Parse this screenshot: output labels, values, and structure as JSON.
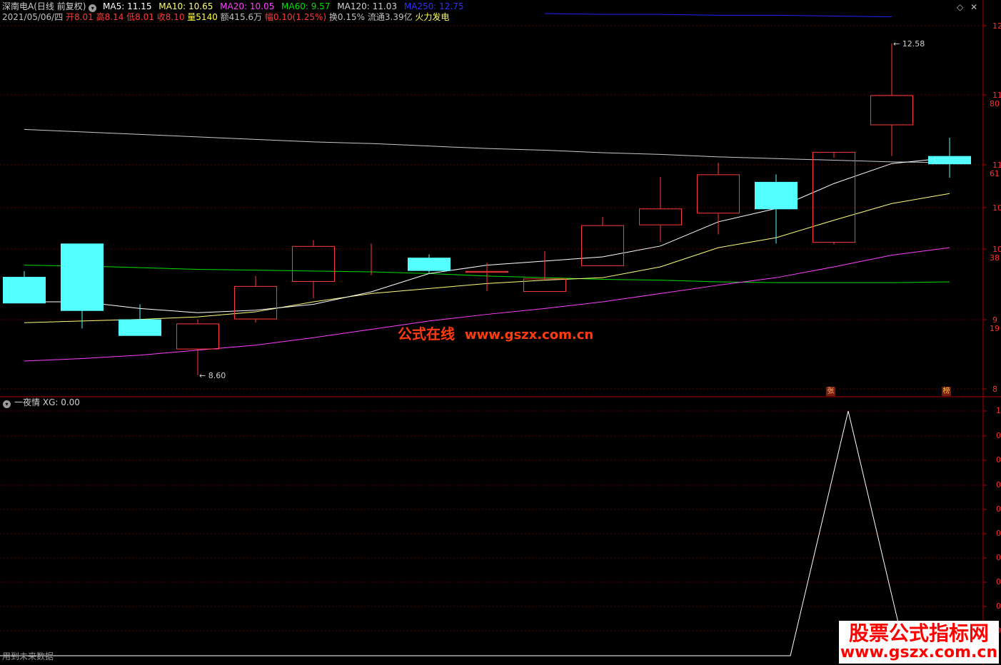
{
  "header": {
    "stock": "深南电A(日线 前复权)",
    "ma5": "MA5: 11.15",
    "ma10": "MA10: 10.65",
    "ma20": "MA20: 10.05",
    "ma60": "MA60: 9.57",
    "ma120": "MA120: 11.03",
    "ma250": "MA250: 12.75"
  },
  "quote": {
    "date": "2021/05/06/四",
    "open": "开8.01",
    "high": "高8.14",
    "low": "低8.01",
    "close": "收8.10",
    "volume": "量5140",
    "amount": "额415.6万",
    "change": "幅0.10(1.25%)",
    "turnover": "换0.15%",
    "float": "流通3.39亿",
    "sector": "火力发电"
  },
  "annotations": {
    "high_label": "12.58",
    "low_label": "8.60",
    "badge_zhang": "张",
    "badge_bang": "榜"
  },
  "axis": {
    "right_labels": [
      "12",
      "11",
      "80",
      "11",
      "61",
      "10",
      "10",
      "38",
      "9",
      "19",
      "8"
    ],
    "ind_labels": [
      "1",
      "0",
      "0",
      "0",
      "0",
      "0",
      "0",
      "0",
      "0",
      "0"
    ]
  },
  "indicator": {
    "name": "一夜情",
    "value": "XG: 0.00"
  },
  "footer": {
    "note": "用到未来数据"
  },
  "watermark": {
    "cn": "公式在线",
    "url": "www.gszx.com.cn"
  },
  "brand": {
    "title": "股票公式指标网",
    "url": "www.gszx.com.cn"
  },
  "colors": {
    "up": "#ff3a3a",
    "down": "#54ffff",
    "ma5": "#ffffff",
    "ma10": "#ffff80",
    "ma20": "#ff40ff",
    "ma60": "#00e000",
    "ma120": "#c8c8c8",
    "ma250": "#2020ff"
  },
  "chart_data": {
    "type": "candlestick",
    "candles": [
      {
        "o": 9.78,
        "h": 9.85,
        "l": 9.48,
        "c": 9.47
      },
      {
        "o": 10.18,
        "h": 10.18,
        "l": 9.16,
        "c": 9.38
      },
      {
        "o": 9.27,
        "h": 9.45,
        "l": 9.08,
        "c": 9.08
      },
      {
        "o": 8.91,
        "h": 9.27,
        "l": 8.6,
        "c": 9.22
      },
      {
        "o": 9.27,
        "h": 9.79,
        "l": 9.23,
        "c": 9.67
      },
      {
        "o": 9.72,
        "h": 10.22,
        "l": 9.52,
        "c": 10.15
      },
      {
        "o": 10.03,
        "h": 10.18,
        "l": 9.8,
        "c": 10.03
      },
      {
        "o": 10.01,
        "h": 10.05,
        "l": 9.82,
        "c": 9.86
      },
      {
        "o": 9.83,
        "h": 9.95,
        "l": 9.61,
        "c": 9.85
      },
      {
        "o": 9.6,
        "h": 10.09,
        "l": 9.6,
        "c": 9.76
      },
      {
        "o": 9.91,
        "h": 10.5,
        "l": 9.91,
        "c": 10.4
      },
      {
        "o": 10.4,
        "h": 10.98,
        "l": 10.2,
        "c": 10.6
      },
      {
        "o": 10.54,
        "h": 11.15,
        "l": 10.29,
        "c": 11.01
      },
      {
        "o": 10.92,
        "h": 11.01,
        "l": 10.18,
        "c": 10.6
      },
      {
        "o": 10.19,
        "h": 11.21,
        "l": 10.17,
        "c": 11.28
      },
      {
        "o": 11.6,
        "h": 12.58,
        "l": 11.23,
        "c": 11.96
      },
      {
        "o": 11.23,
        "h": 11.45,
        "l": 10.97,
        "c": 11.14
      }
    ],
    "ma5": [
      9.48,
      9.48,
      9.4,
      9.35,
      9.38,
      9.45,
      9.6,
      9.82,
      9.92,
      9.97,
      10.02,
      10.15,
      10.44,
      10.6,
      10.9,
      11.14,
      11.21
    ],
    "ma10": [
      9.23,
      9.25,
      9.27,
      9.3,
      9.36,
      9.48,
      9.58,
      9.64,
      9.7,
      9.74,
      9.77,
      9.9,
      10.13,
      10.25,
      10.46,
      10.66,
      10.78
    ],
    "ma20": [
      8.77,
      8.8,
      8.84,
      8.9,
      8.96,
      9.05,
      9.15,
      9.25,
      9.33,
      9.4,
      9.48,
      9.58,
      9.68,
      9.77,
      9.9,
      10.04,
      10.13
    ],
    "ma60": [
      9.92,
      9.91,
      9.89,
      9.87,
      9.86,
      9.85,
      9.84,
      9.82,
      9.79,
      9.77,
      9.75,
      9.74,
      9.72,
      9.71,
      9.71,
      9.71,
      9.72
    ],
    "ma120": [
      11.55,
      11.52,
      11.49,
      11.46,
      11.43,
      11.4,
      11.38,
      11.35,
      11.32,
      11.3,
      11.27,
      11.25,
      11.22,
      11.2,
      11.18,
      11.16,
      11.15
    ],
    "ma250_segment": [
      12.94,
      12.93,
      12.93,
      12.92,
      12.92,
      12.91,
      12.9
    ],
    "xg": [
      0,
      0,
      0,
      0,
      0,
      0,
      0,
      0,
      0,
      0,
      0,
      0,
      0,
      0,
      1,
      0,
      0
    ],
    "price_range": [
      8.35,
      13.0
    ]
  }
}
